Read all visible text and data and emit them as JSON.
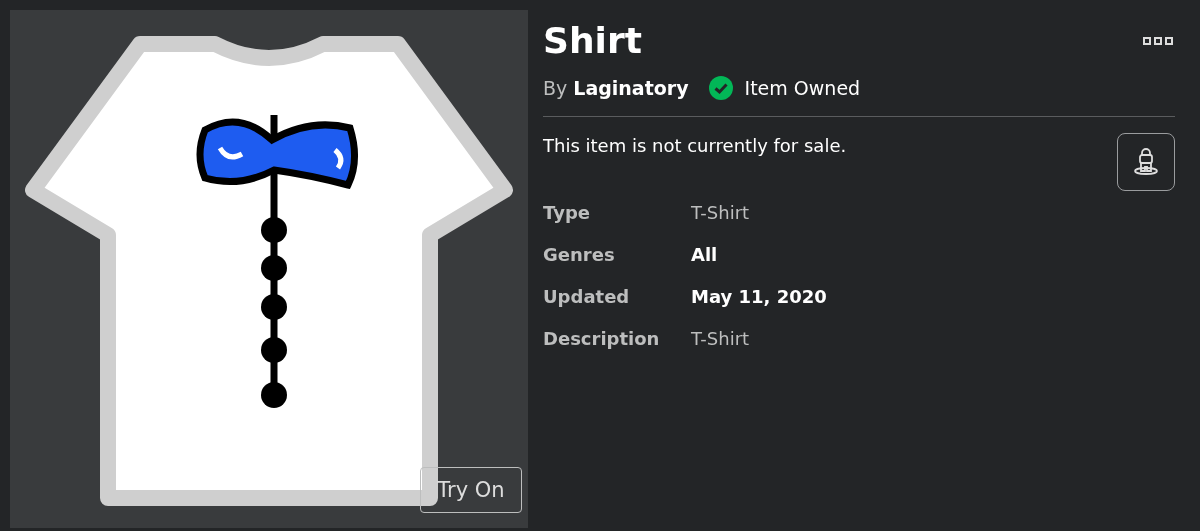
{
  "item": {
    "title": "Shirt",
    "by_label": "By",
    "creator": "Laginatory",
    "owned": true,
    "owned_label": "Item Owned",
    "sale_note": "This item is not currently for sale.",
    "try_on": "Try On"
  },
  "details": [
    {
      "label": "Type",
      "value": "T-Shirt",
      "emphasis": false
    },
    {
      "label": "Genres",
      "value": "All",
      "emphasis": true
    },
    {
      "label": "Updated",
      "value": "May 11, 2020",
      "emphasis": true
    },
    {
      "label": "Description",
      "value": "T-Shirt",
      "emphasis": false
    }
  ]
}
